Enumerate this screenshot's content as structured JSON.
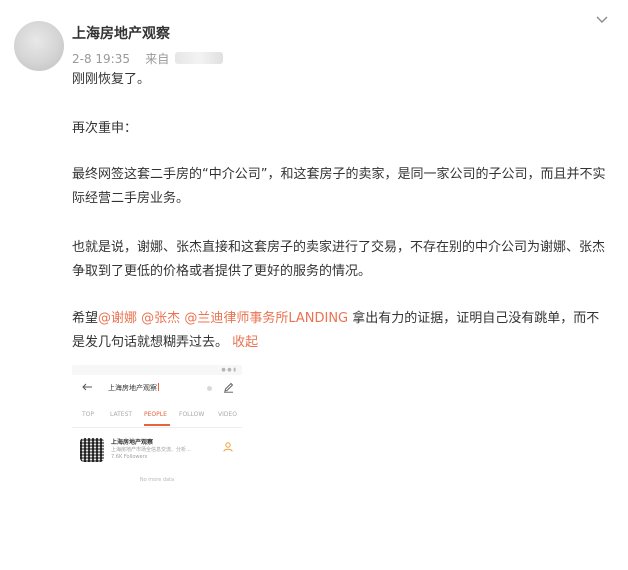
{
  "post": {
    "author": "上海房地产观察",
    "time": "2-8 19:35",
    "source_label": "来自",
    "paragraphs": {
      "p1": "刚刚恢复了。",
      "p2": "再次重申：",
      "p3": "最终网签这套二手房的“中介公司”，和这套房子的卖家，是同一家公司的子公司，而且并不实际经营二手房业务。",
      "p4": "也就是说，谢娜、张杰直接和这套房子的卖家进行了交易，不存在别的中介公司为谢娜、张杰争取到了更低的价格或者提供了更好的服务的情况。"
    },
    "closing": {
      "prefix": "希望",
      "mention1": "@谢娜",
      "mention2": "@张杰",
      "mention3": "@兰迪律师事务所LANDING",
      "body": " 拿出有力的证据，证明自己没有跳单，而不是发几句话就想糊弄过去。",
      "collapse_label": "收起"
    }
  },
  "screenshot": {
    "search_query": "上海房地产观察",
    "tabs": [
      "TOP",
      "LATEST",
      "PEOPLE",
      "FOLLOW",
      "VIDEO"
    ],
    "active_tab": "PEOPLE",
    "result": {
      "name": "上海房地产观察",
      "desc": "上海房地产市场全信息交流、分析...",
      "followers": "7.6K Followers"
    },
    "no_more": "No more data"
  },
  "colors": {
    "accent": "#eb7350",
    "text": "#333333",
    "meta": "#999999"
  },
  "icons": {
    "menu": "chevron-down-icon",
    "back": "arrow-left-icon",
    "edit": "pen-icon",
    "add_user": "add-user-icon"
  }
}
